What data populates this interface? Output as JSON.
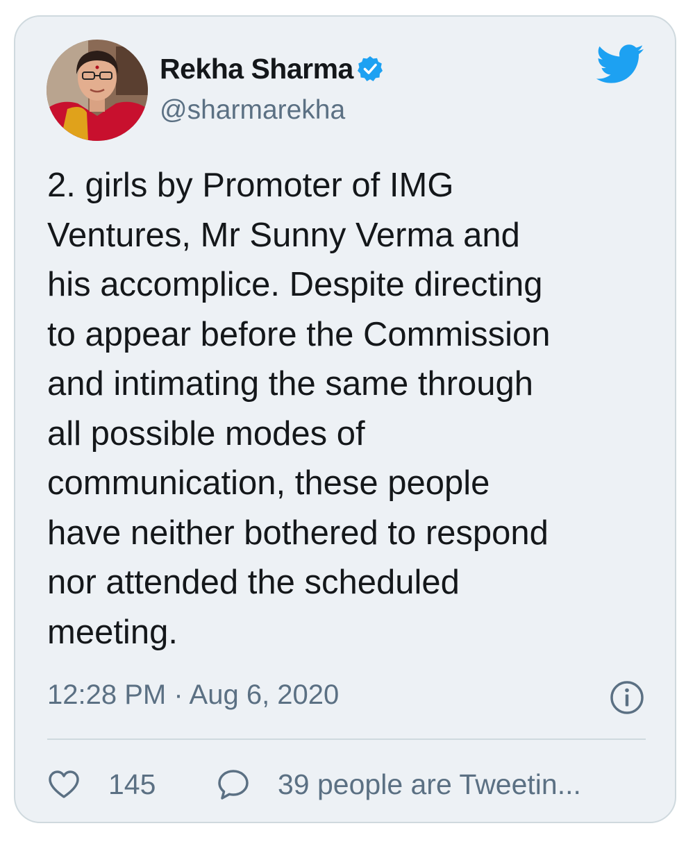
{
  "author": {
    "name": "Rekha Sharma",
    "handle": "@sharmarekha",
    "verified": true
  },
  "tweet": {
    "text": "2. girls by Promoter of IMG\nVentures, Mr Sunny Verma and\nhis accomplice. Despite directing\nto appear before the Commission\nand intimating the same through\nall possible modes of\ncommunication, these people\nhave neither bothered to respond\nnor attended the scheduled\nmeeting.",
    "timestamp": "12:28 PM · Aug 6, 2020"
  },
  "actions": {
    "likes": "145",
    "tweeting": "39 people are Tweetin..."
  },
  "icons": {
    "brand": "twitter-bird-icon",
    "verified": "verified-badge-icon",
    "info": "info-icon",
    "like": "heart-icon",
    "reply": "speech-bubble-icon"
  },
  "colors": {
    "card_background": "#edf1f5",
    "brand_blue": "#1da1f2",
    "secondary_text": "#5b7083",
    "primary_text": "#14171a"
  }
}
